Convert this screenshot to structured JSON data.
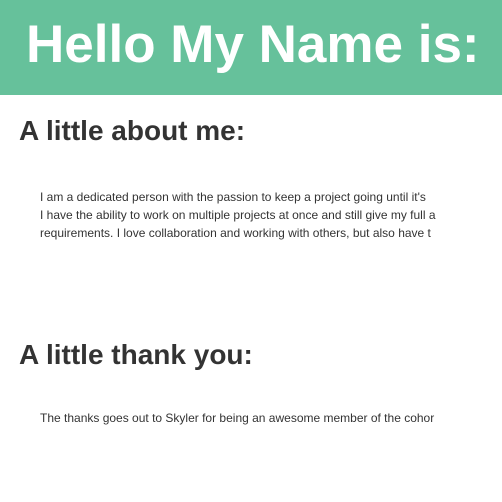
{
  "header": {
    "title": "Hello My Name is:"
  },
  "about": {
    "heading": "A little about me:",
    "lines": [
      "I am a dedicated person with the passion to keep a project going until it's",
      "I have the ability to work on multiple projects at once and still give my full a",
      "requirements. I love collaboration and working with others, but also have t"
    ]
  },
  "thanks": {
    "heading": "A little thank you:",
    "text": "The thanks goes out to Skyler for being an awesome member of the cohor"
  },
  "colors": {
    "header_bg": "#66c19b",
    "header_text": "#ffffff",
    "body_text": "#333333"
  }
}
